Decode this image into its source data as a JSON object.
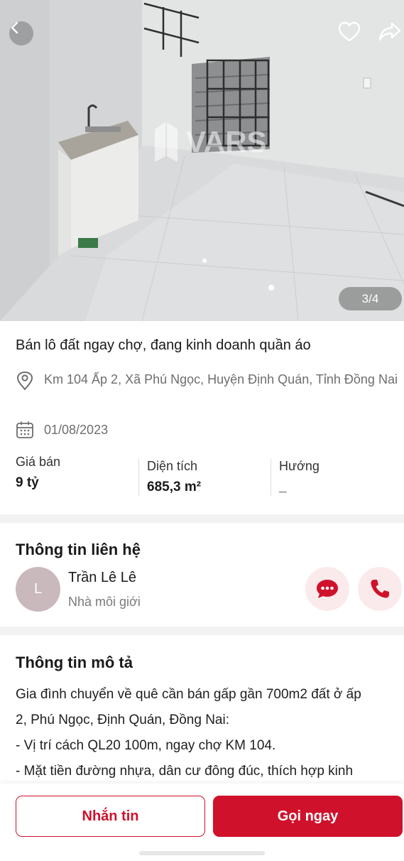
{
  "gallery": {
    "counter": "3/4",
    "watermark": "VARS"
  },
  "listing": {
    "title": "Bán lô đất ngay chợ, đang kinh doanh quần áo",
    "address": "Km 104 Ấp 2, Xã Phú Ngọc, Huyện Định Quán, Tỉnh Đồng Nai",
    "date": "01/08/2023",
    "stats": [
      {
        "label": "Giá bán",
        "value": "9 tỷ"
      },
      {
        "label": "Diện tích",
        "value": "685,3 m²"
      },
      {
        "label": "Hướng",
        "value": "_"
      }
    ]
  },
  "contact": {
    "title": "Thông tin liên hệ",
    "avatar_initial": "L",
    "name": "Trần Lê Lê",
    "role": "Nhà môi giới"
  },
  "description": {
    "title": "Thông tin mô tả",
    "lines": [
      "Gia đình chuyển về quê cần bán gấp gần 700m2 đất ở ấp",
      "2, Phú Ngọc, Định Quán, Đồng Nai:",
      "- Vị trí cách QL20 100m, ngay chợ KM 104.",
      "- Mặt tiền đường nhựa, dân cư đông đúc, thích hợp kinh"
    ]
  },
  "actions": {
    "message_label": "Nhắn tin",
    "call_label": "Gọi ngay"
  },
  "icons": {
    "back": "chevron-left-icon",
    "favorite": "heart-icon",
    "share": "share-icon",
    "location": "map-pin-icon",
    "calendar": "calendar-icon",
    "chat": "chat-bubble-icon",
    "phone": "phone-icon"
  },
  "colors": {
    "accent": "#d0112b",
    "accent_soft": "#fbeaec",
    "muted_text": "#6e6e6e"
  }
}
